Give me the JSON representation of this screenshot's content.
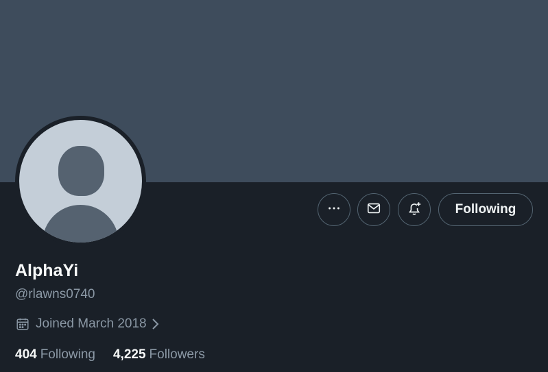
{
  "profile": {
    "name": "AlphaYi",
    "handle": "@rlawns0740",
    "joined": "Joined March 2018",
    "stats": {
      "following_count": "404",
      "following_label": "Following",
      "followers_count": "4,225",
      "followers_label": "Followers"
    }
  },
  "actions": {
    "more_icon": "more-horizontal-icon",
    "message_icon": "envelope-icon",
    "notify_icon": "bell-plus-icon",
    "following_label": "Following"
  },
  "colors": {
    "banner": "#3e4c5c",
    "background": "#1a2028",
    "avatar_bg": "#c4ced8",
    "avatar_silhouette": "#556270",
    "text_primary": "#f7f9f9",
    "text_secondary": "#8b98a5",
    "button_border": "#536471"
  }
}
